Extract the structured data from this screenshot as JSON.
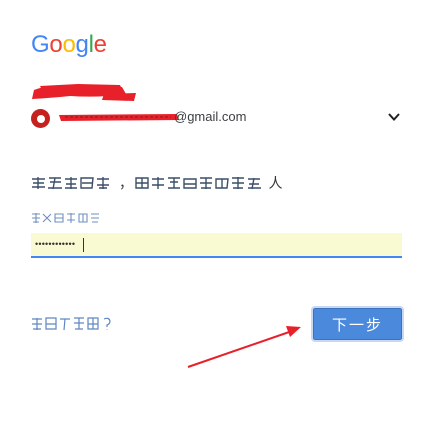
{
  "brand": {
    "logo_letters": [
      "G",
      "o",
      "o",
      "g",
      "l",
      "e"
    ],
    "logo_colors": [
      "#4285F4",
      "#EA4335",
      "#FBBC05",
      "#4285F4",
      "#34A853",
      "#EA4335"
    ]
  },
  "account": {
    "email_domain": "@gmail.com",
    "avatar_color": "#C5221F",
    "redaction_color": "#E8202A"
  },
  "prompt": {
    "middle": "，",
    "end": "人"
  },
  "password": {
    "masked_value": "••••••••••••"
  },
  "actions": {
    "next_label": "下一步"
  },
  "annotation": {
    "arrow_color": "#E8202A"
  },
  "icons": {
    "chevron": "chevron-down-icon",
    "avatar": "avatar-icon"
  }
}
